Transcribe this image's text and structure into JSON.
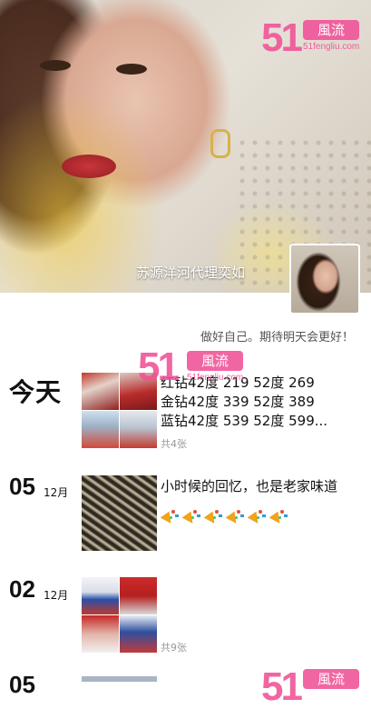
{
  "cover": {
    "watermark": {
      "number": "51",
      "chip": "風流",
      "url": "51fengliu.com"
    },
    "name": "苏源洋河代理奕如"
  },
  "profile": {
    "signature": "做好自己。期待明天会更好！"
  },
  "feed_watermark": {
    "number": "51",
    "chip": "風流",
    "url": "51fengliu.com"
  },
  "bottom_watermark": {
    "number": "51",
    "chip": "風流"
  },
  "posts": [
    {
      "date_label": "今天",
      "lines": [
        "红钻42度 219      52度 269",
        "金钻42度 339      52度 389",
        "蓝钻42度 539      52度 599..."
      ],
      "count": "共4张"
    },
    {
      "day": "05",
      "month": "12月",
      "text": "小时候的回忆，也是老家味道",
      "emoji": "party-popper-icon"
    },
    {
      "day": "02",
      "month": "12月",
      "count": "共9张"
    },
    {
      "day": "05"
    }
  ]
}
